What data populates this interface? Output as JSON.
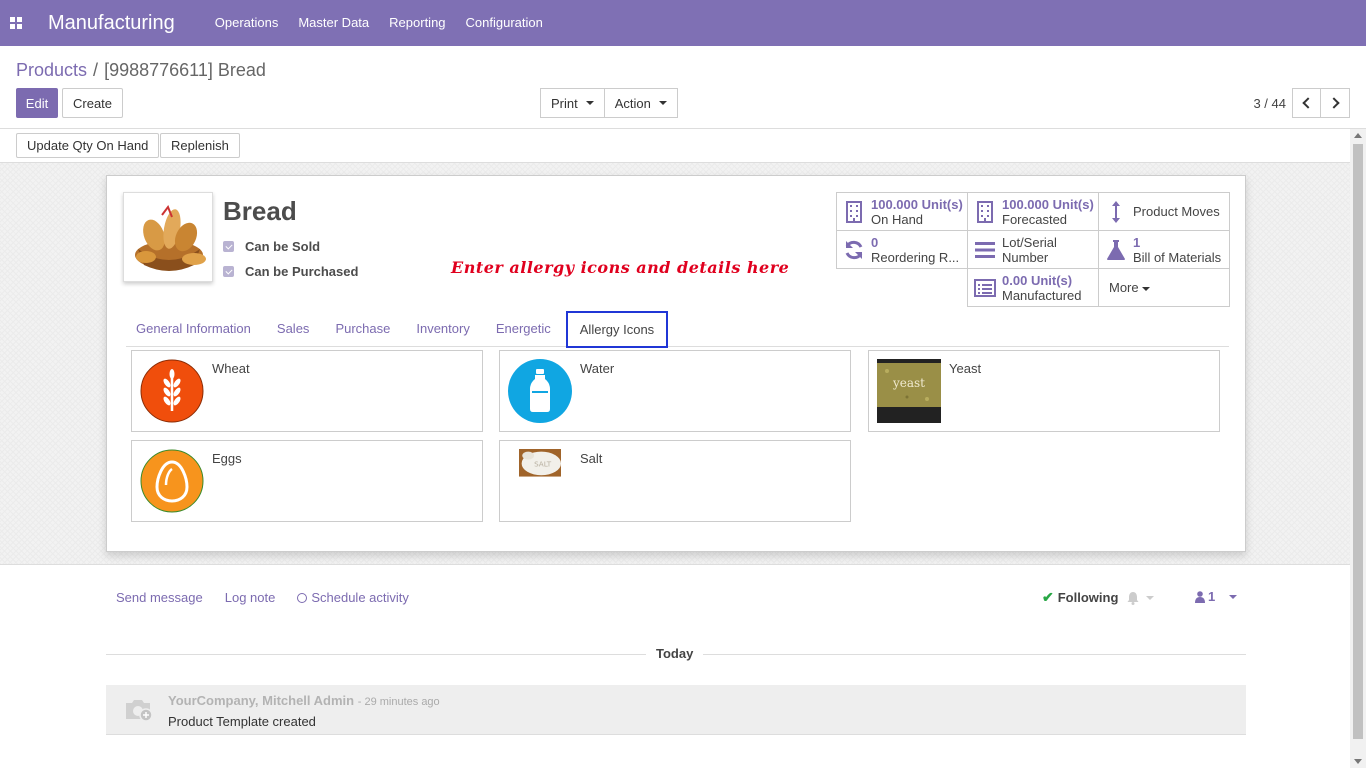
{
  "app": {
    "title": "Manufacturing",
    "menu": [
      "Operations",
      "Master Data",
      "Reporting",
      "Configuration"
    ]
  },
  "breadcrumb": {
    "parent": "Products",
    "separator": "/",
    "current": "[9988776611] Bread"
  },
  "toolbar": {
    "edit_label": "Edit",
    "create_label": "Create",
    "print_label": "Print",
    "action_label": "Action",
    "pager": "3 / 44"
  },
  "statusbar": {
    "update_qty_label": "Update Qty On Hand",
    "replenish_label": "Replenish"
  },
  "product": {
    "name": "Bread",
    "can_be_sold_label": "Can be Sold",
    "can_be_sold": true,
    "can_be_purchased_label": "Can be Purchased",
    "can_be_purchased": true,
    "image_icon": "bread-basket-image"
  },
  "annotation": "Enter allergy icons and details here",
  "stats": {
    "on_hand": {
      "value": "100.000",
      "unit": "Unit(s)",
      "label": "On Hand",
      "icon": "building-icon"
    },
    "forecasted": {
      "value": "100.000",
      "unit": "Unit(s)",
      "label": "Forecasted",
      "icon": "building-icon"
    },
    "product_moves": {
      "label": "Product Moves",
      "icon": "arrows-v-icon"
    },
    "reordering": {
      "value": "0",
      "label": "Reordering R...",
      "icon": "refresh-icon"
    },
    "lot_serial": {
      "label_1": "Lot/Serial",
      "label_2": "Number",
      "icon": "bars-icon"
    },
    "bom": {
      "value": "1",
      "label": "Bill of Materials",
      "icon": "flask-icon"
    },
    "manufactured": {
      "value": "0.00",
      "unit": "Unit(s)",
      "label": "Manufactured",
      "icon": "list-alt-icon"
    },
    "more_label": "More"
  },
  "tabs": [
    {
      "label": "General Information",
      "active": false
    },
    {
      "label": "Sales",
      "active": false
    },
    {
      "label": "Purchase",
      "active": false
    },
    {
      "label": "Inventory",
      "active": false
    },
    {
      "label": "Energetic",
      "active": false
    },
    {
      "label": "Allergy Icons",
      "active": true
    }
  ],
  "allergies": [
    {
      "name": "Wheat",
      "icon": "wheat-icon",
      "color": "#f04e0c"
    },
    {
      "name": "Water",
      "icon": "water-bottle-icon",
      "color": "#10a6e2"
    },
    {
      "name": "Yeast",
      "icon": "yeast-image",
      "image_text": "yeast"
    },
    {
      "name": "Eggs",
      "icon": "egg-icon",
      "color": "#f7941d"
    },
    {
      "name": "Salt",
      "icon": "salt-image",
      "image_text": "SALT"
    }
  ],
  "chatter": {
    "send_message": "Send message",
    "log_note": "Log note",
    "schedule_activity": "Schedule activity",
    "following": "Following",
    "followers_count": "1",
    "today_label": "Today",
    "message": {
      "author": "YourCompany, Mitchell Admin",
      "time": "- 29 minutes ago",
      "body": "Product Template created"
    }
  },
  "colors": {
    "brand": "#7f70b4",
    "link": "#7c6bb0",
    "annotation": "#e0001e"
  }
}
